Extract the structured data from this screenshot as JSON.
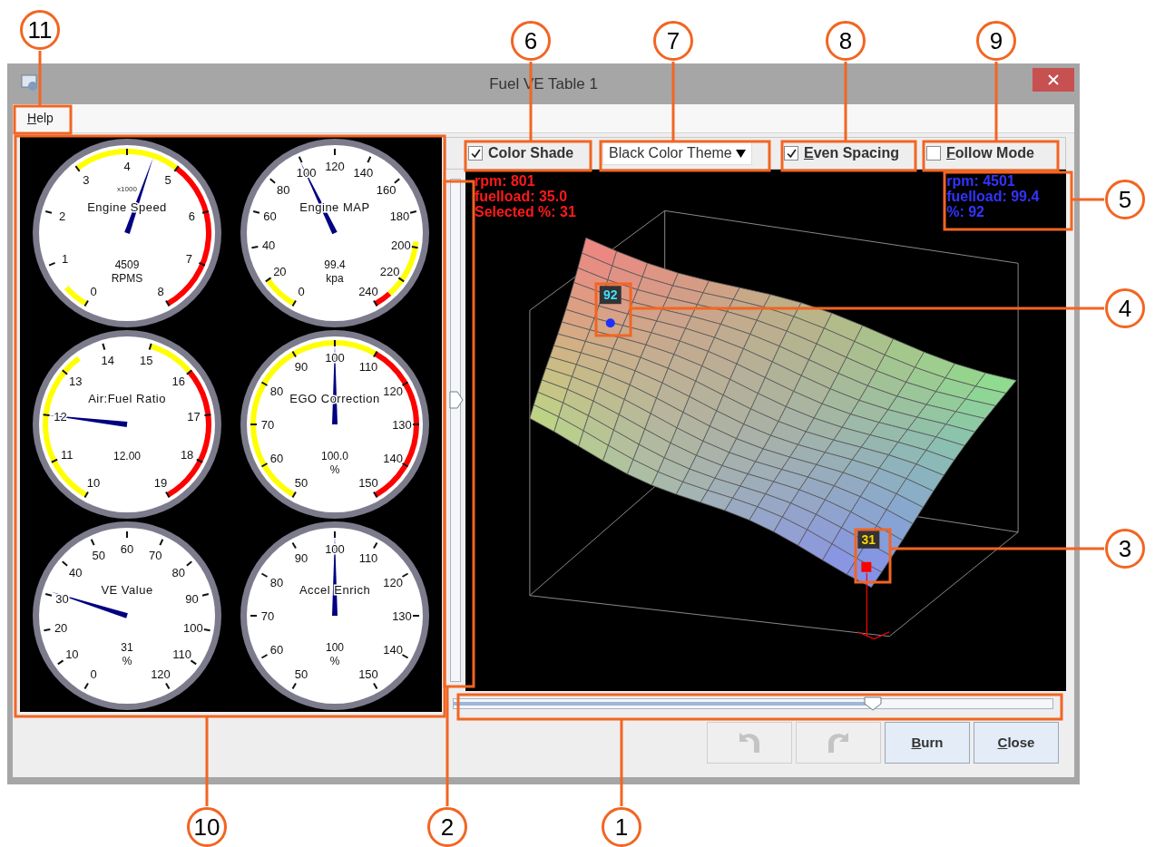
{
  "annotations": [
    {
      "label": "11"
    },
    {
      "label": "6"
    },
    {
      "label": "7"
    },
    {
      "label": "8"
    },
    {
      "label": "9"
    },
    {
      "label": "5"
    },
    {
      "label": "4"
    },
    {
      "label": "3"
    },
    {
      "label": "10"
    },
    {
      "label": "2"
    },
    {
      "label": "1"
    }
  ],
  "window": {
    "title": "Fuel VE Table 1"
  },
  "menu": [
    {
      "label": "Help"
    }
  ],
  "gauges": [
    {
      "title": "Engine Speed",
      "multiplier": "x1000",
      "ticks": [
        "0",
        "1",
        "2",
        "3",
        "4",
        "5",
        "6",
        "7",
        "8"
      ],
      "value": "4509",
      "unit": "RPMS",
      "bands": [
        {
          "color": "#ffff00"
        },
        {
          "color": "#ffff00"
        },
        {
          "color": "#ff0000"
        }
      ]
    },
    {
      "title": "Engine MAP",
      "ticks": [
        "0",
        "20",
        "40",
        "60",
        "80",
        "100",
        "120",
        "140",
        "160",
        "180",
        "200",
        "220",
        "240"
      ],
      "value": "99.4",
      "unit": "kpa",
      "bands": [
        {
          "color": "#ffff00"
        },
        {
          "color": "#ffff00"
        },
        {
          "color": "#ff0000"
        }
      ]
    },
    {
      "title": "Air:Fuel Ratio",
      "ticks": [
        "10",
        "11",
        "12",
        "13",
        "14",
        "15",
        "16",
        "17",
        "18",
        "19"
      ],
      "value": "12.00",
      "bands": [
        {
          "color": "#ffff00"
        },
        {
          "color": "#ffff00"
        },
        {
          "color": "#ff0000"
        }
      ]
    },
    {
      "title": "EGO Correction",
      "ticks": [
        "50",
        "60",
        "70",
        "80",
        "90",
        "100",
        "110",
        "120",
        "130",
        "140",
        "150"
      ],
      "value": "100.0",
      "unit": "%",
      "bands": [
        {
          "color": "#ffff00"
        },
        {
          "color": "#ff0000"
        }
      ]
    },
    {
      "title": "VE Value",
      "ticks": [
        "0",
        "10",
        "20",
        "30",
        "40",
        "50",
        "60",
        "70",
        "80",
        "90",
        "100",
        "110",
        "120"
      ],
      "value": "31",
      "unit": "%"
    },
    {
      "title": "Accel Enrich",
      "ticks": [
        "50",
        "60",
        "70",
        "80",
        "90",
        "100",
        "110",
        "120",
        "130",
        "140",
        "150"
      ],
      "value": "100",
      "unit": "%"
    }
  ],
  "toolbar": [
    {
      "kind": "checkbox",
      "label": "Color Shade",
      "checked": true,
      "mnemonic": false
    },
    {
      "kind": "dropdown",
      "value": "Black Color Theme"
    },
    {
      "kind": "checkbox",
      "label": "Even Spacing",
      "checked": true,
      "mnemonic": true
    },
    {
      "kind": "checkbox",
      "label": "Follow Mode",
      "checked": false,
      "mnemonic": true
    }
  ],
  "plot": {
    "selected_info": [
      "rpm: 801",
      "fuelload: 35.0",
      "Selected %: 31"
    ],
    "hover_info": [
      "rpm: 4501",
      "fuelload: 99.4",
      "%: 92"
    ],
    "markers": [
      {
        "kind": "hover",
        "label": "92"
      },
      {
        "kind": "selected",
        "label": "31"
      }
    ]
  },
  "vertical_slider": {
    "level": 0.56
  },
  "horizontal_slider": {
    "level": 0.7
  },
  "buttons": [
    {
      "kind": "undo",
      "disabled": true
    },
    {
      "kind": "redo",
      "disabled": true
    },
    {
      "kind": "text",
      "label": "Burn",
      "disabled": false
    },
    {
      "kind": "text",
      "label": "Close",
      "disabled": false
    }
  ]
}
